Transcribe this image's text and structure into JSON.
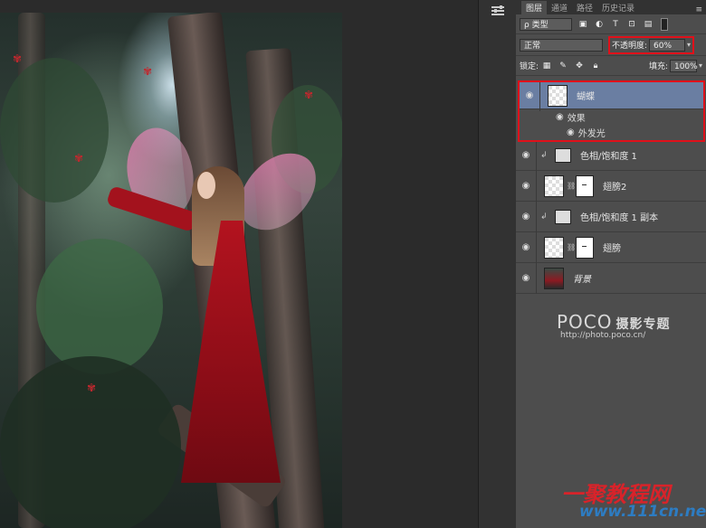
{
  "panel": {
    "tabs": [
      "图层",
      "通道",
      "路径",
      "历史记录"
    ],
    "filter_kind": "ρ 类型",
    "blend_mode": "正常",
    "opacity_label": "不透明度:",
    "opacity_value": "60%",
    "lock_label": "锁定:",
    "fill_label": "填充:",
    "fill_value": "100%"
  },
  "layers": [
    {
      "name": "蝴蝶",
      "kind": "pixel",
      "selected": true
    },
    {
      "name": "色相/饱和度 1",
      "kind": "adjustment"
    },
    {
      "name": "翅膀2",
      "kind": "masked"
    },
    {
      "name": "色相/饱和度 1 副本",
      "kind": "adjustment"
    },
    {
      "name": "翅膀",
      "kind": "masked"
    },
    {
      "name": "背景",
      "kind": "background"
    }
  ],
  "effects": {
    "label": "效果",
    "item": "外发光"
  },
  "watermarks": {
    "poco": "POCO",
    "poco_title": "摄影专题",
    "poco_url": "http://photo.poco.cn/",
    "site_logo": "一聚教程网",
    "site_url": "www.111cn.net"
  },
  "icons": {
    "eye": "eye-icon",
    "panel_menu": "panel-menu-icon",
    "link": "chain-link-icon"
  },
  "colors": {
    "highlight": "#e0101a",
    "selected_layer": "#6a7ea2"
  }
}
